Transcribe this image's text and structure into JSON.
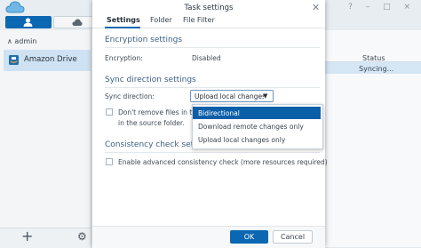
{
  "colors": {
    "accent": "#0b67b1",
    "selection": "#0b5fa8",
    "section_title": "#3d5f82"
  },
  "app": {
    "group_label": "admin",
    "connection": "Amazon Drive",
    "table_header_status": "Status",
    "row_status": "Syncing..."
  },
  "dialog": {
    "title": "Task settings",
    "tabs": [
      "Settings",
      "Folder",
      "File Filter"
    ],
    "encryption": {
      "section": "Encryption settings",
      "label": "Encryption:",
      "value": "Disabled"
    },
    "sync": {
      "section": "Sync direction settings",
      "label": "Sync direction:",
      "selected": "Upload local changes o",
      "options": [
        "Bidirectional",
        "Download remote changes only",
        "Upload local changes only"
      ],
      "dont_remove_line1": "Don't remove files in the",
      "dont_remove_line2": "in the source folder."
    },
    "consistency": {
      "section": "Consistency check settin",
      "checkbox_label": "Enable advanced consistency check (more resources required)"
    },
    "ok_label": "OK",
    "cancel_label": "Cancel"
  }
}
